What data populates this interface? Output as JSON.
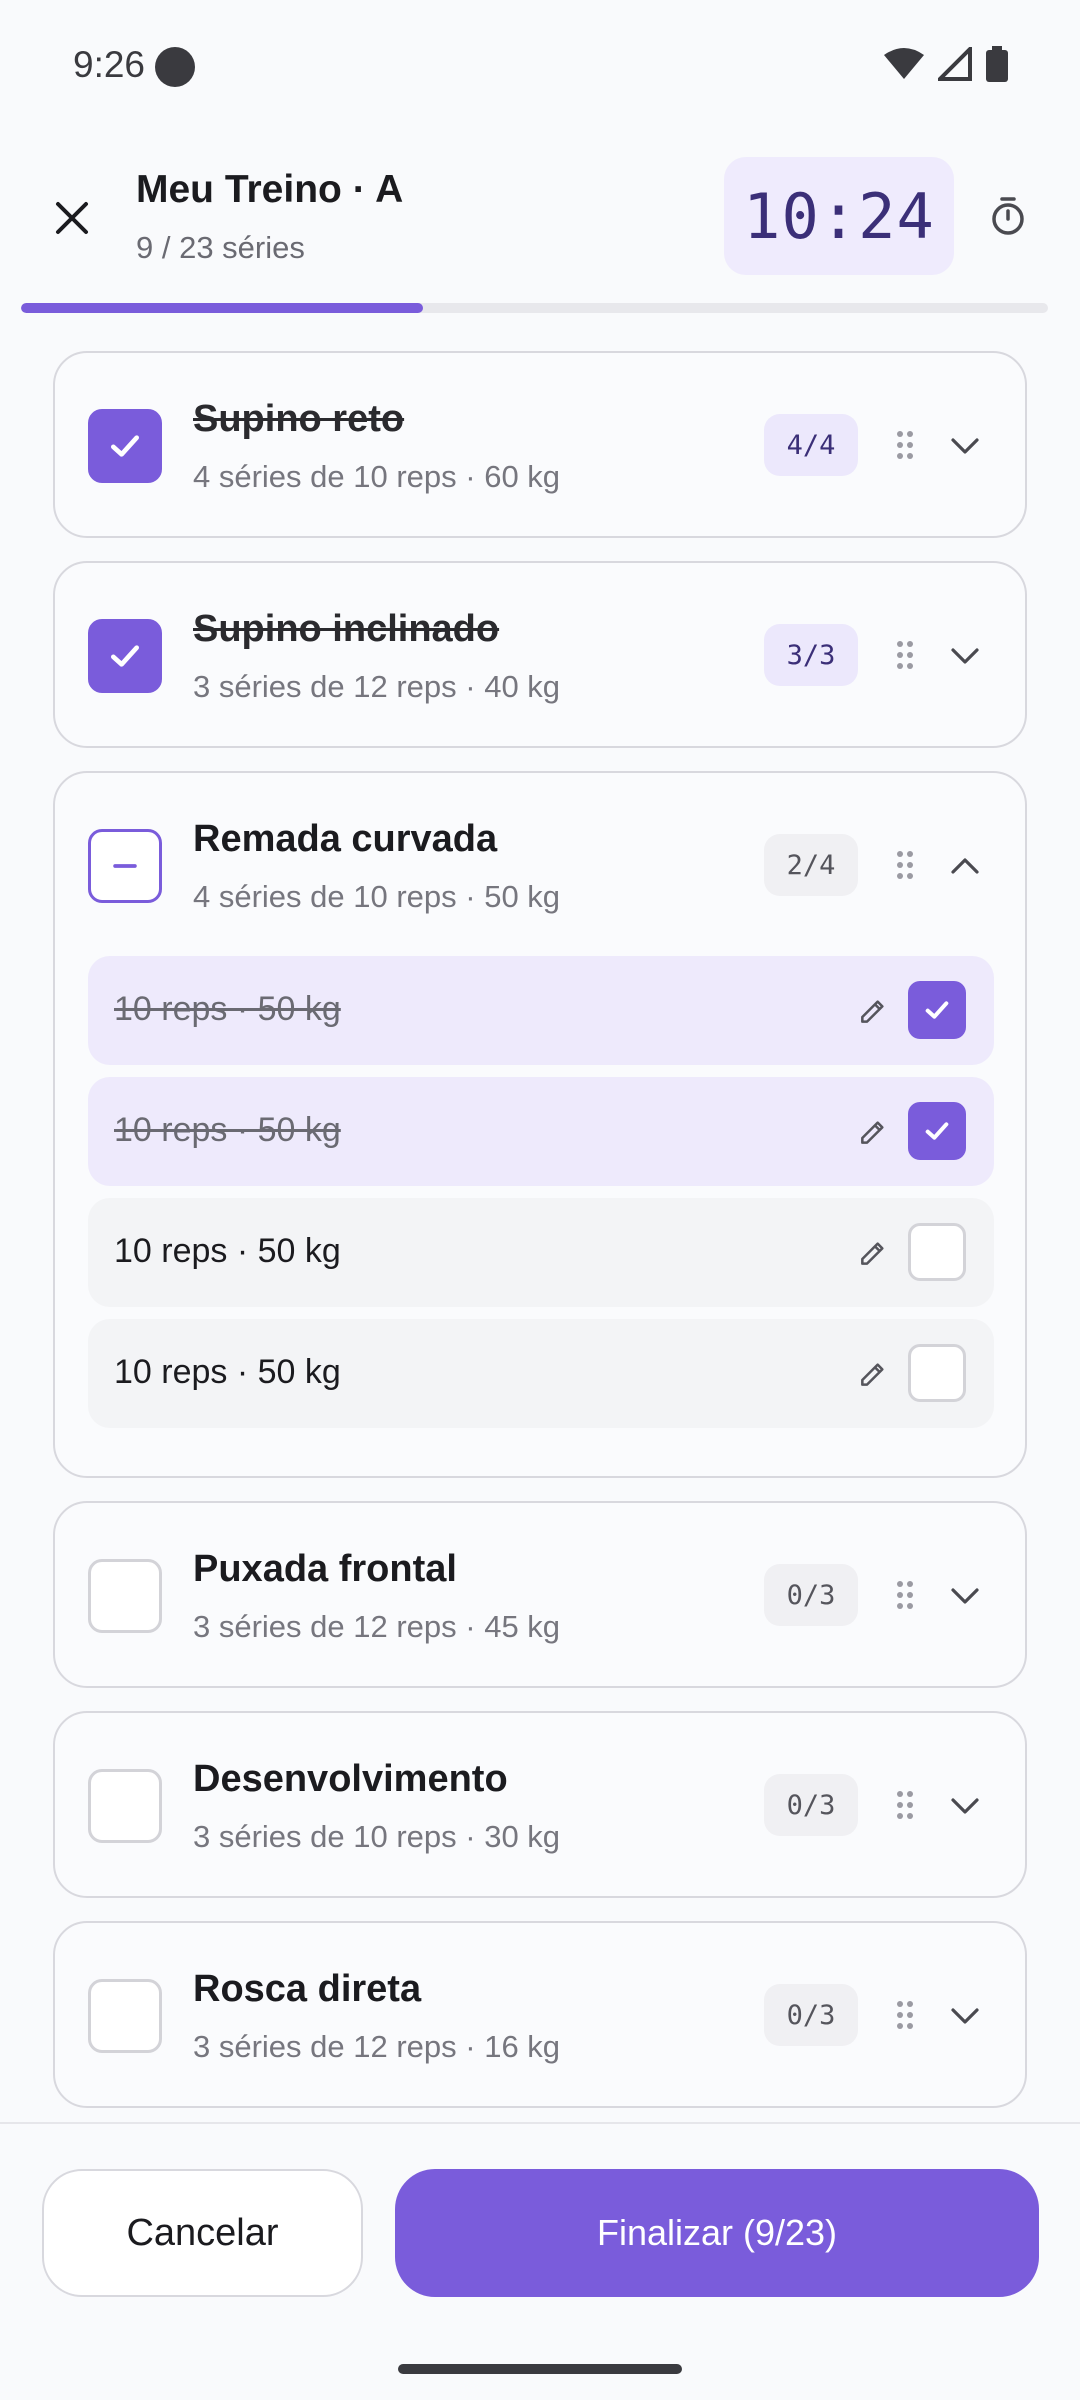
{
  "status_bar": {
    "time": "9:26"
  },
  "header": {
    "title": "Meu Treino · A",
    "subtitle": "9 / 23 séries",
    "timer": "10:24"
  },
  "progress": {
    "completed": 9,
    "total": 23,
    "fraction": 0.391
  },
  "colors": {
    "accent": "#7A5CDB",
    "accent_light": "#EEEAFC",
    "timer_text": "#3B2F78"
  },
  "exercises": [
    {
      "name": "Supino reto",
      "detail": "4 séries de 10 reps · 60 kg",
      "count": "4/4",
      "state": "done"
    },
    {
      "name": "Supino inclinado",
      "detail": "3 séries de 12 reps · 40 kg",
      "count": "3/3",
      "state": "done"
    },
    {
      "name": "Remada curvada",
      "detail": "4 séries de 10 reps · 50 kg",
      "count": "2/4",
      "state": "partial",
      "sets": [
        {
          "label": "10 reps · 50 kg",
          "done": true
        },
        {
          "label": "10 reps · 50 kg",
          "done": true
        },
        {
          "label": "10 reps · 50 kg",
          "done": false
        },
        {
          "label": "10 reps · 50 kg",
          "done": false
        }
      ]
    },
    {
      "name": "Puxada frontal",
      "detail": "3 séries de 12 reps · 45 kg",
      "count": "0/3",
      "state": "todo"
    },
    {
      "name": "Desenvolvimento",
      "detail": "3 séries de 10 reps · 30 kg",
      "count": "0/3",
      "state": "todo"
    },
    {
      "name": "Rosca direta",
      "detail": "3 séries de 12 reps · 16 kg",
      "count": "0/3",
      "state": "todo"
    }
  ],
  "footer": {
    "cancel_label": "Cancelar",
    "finish_label": "Finalizar (9/23)"
  },
  "icons": {
    "close": "close-icon",
    "stopwatch": "stopwatch-icon",
    "drag": "drag-handle-icon",
    "expand": "chevron-down-icon",
    "collapse": "chevron-up-icon",
    "edit": "pencil-icon",
    "check": "check-icon",
    "partial": "minus-icon"
  }
}
